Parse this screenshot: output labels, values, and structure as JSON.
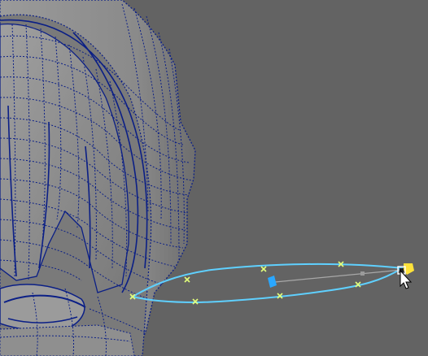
{
  "viewport": {
    "background": "#636363",
    "mesh_fill": "#8c8c8c",
    "mesh_fill_dark": "#747474",
    "wire_color": "#0b1f86",
    "curve_color": "#5fd0ff",
    "cv_marker_color": "#e3ff7a",
    "pivot_color": "#2aa7ff",
    "selected_handle_color": "#ffe23a"
  },
  "mesh": {
    "name_icon": "head-mesh"
  },
  "curve": {
    "name_icon": "nurbs-loop",
    "cv_count": 8
  },
  "cursor": {
    "icon": "arrow-cursor"
  }
}
